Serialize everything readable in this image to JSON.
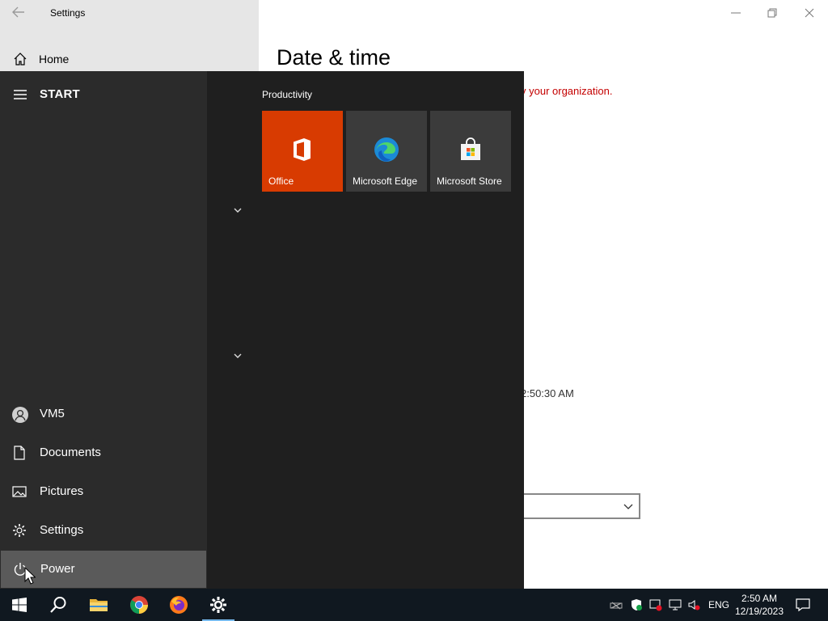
{
  "settings_window": {
    "title": "Settings",
    "home_label": "Home",
    "page_title": "Date & time",
    "org_message": "y your organization.",
    "time_fragment": "2:50:30 AM"
  },
  "start_menu": {
    "header": "START",
    "left_items": [
      {
        "label": "VM5",
        "icon": "user-avatar-icon"
      },
      {
        "label": "Documents",
        "icon": "document-icon"
      },
      {
        "label": "Pictures",
        "icon": "pictures-icon"
      },
      {
        "label": "Settings",
        "icon": "gear-icon"
      },
      {
        "label": "Power",
        "icon": "power-icon"
      }
    ],
    "group_title": "Productivity",
    "tiles": [
      {
        "label": "Office",
        "color": "#d83b01"
      },
      {
        "label": "Microsoft Edge",
        "color": "#3b3b3b"
      },
      {
        "label": "Microsoft Store",
        "color": "#3b3b3b"
      }
    ]
  },
  "taskbar": {
    "apps": [
      "start-button",
      "search",
      "file-explorer",
      "chrome",
      "firefox",
      "settings"
    ],
    "language": "ENG",
    "time": "2:50 AM",
    "date": "12/19/2023"
  },
  "colors": {
    "accent": "#76b9ed",
    "office_orange": "#d83b01",
    "warning_red": "#c40000"
  }
}
